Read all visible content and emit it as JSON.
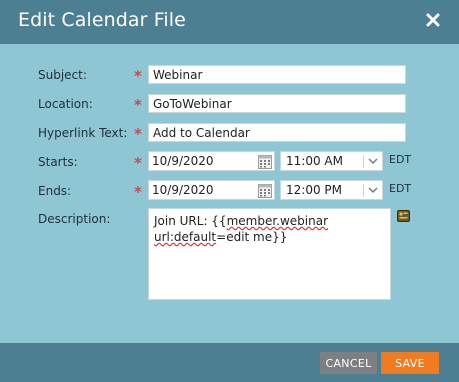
{
  "dialog": {
    "title": "Edit Calendar File"
  },
  "form": {
    "subject": {
      "label": "Subject:",
      "value": "Webinar"
    },
    "location": {
      "label": "Location:",
      "value": "GoToWebinar"
    },
    "hyperlink": {
      "label": "Hyperlink Text:",
      "value": "Add to Calendar"
    },
    "starts": {
      "label": "Starts:",
      "date": "10/9/2020",
      "time": "11:00 AM",
      "tz": "EDT"
    },
    "ends": {
      "label": "Ends:",
      "date": "10/9/2020",
      "time": "12:00 PM",
      "tz": "EDT"
    },
    "description": {
      "label": "Description:",
      "text_prefix": "Join URL: {{",
      "token_1": "member.webinar",
      "space": " ",
      "token_2": "url:default",
      "text_mid": "=edit me}}"
    },
    "required_marker": "*"
  },
  "buttons": {
    "cancel": "CANCEL",
    "save": "SAVE"
  },
  "colors": {
    "header": "#4d7f93",
    "body": "#8ec6d4",
    "save": "#f07c22",
    "cancel": "#7d7f82",
    "required": "#c0504d"
  }
}
